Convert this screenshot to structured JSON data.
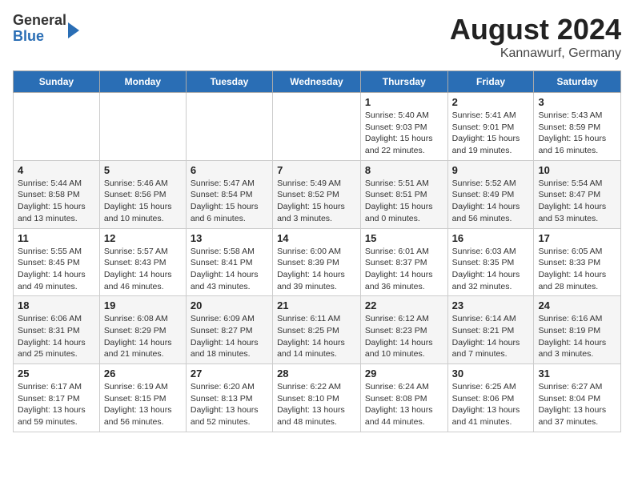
{
  "logo": {
    "general": "General",
    "blue": "Blue"
  },
  "title": {
    "month_year": "August 2024",
    "location": "Kannawurf, Germany"
  },
  "days_of_week": [
    "Sunday",
    "Monday",
    "Tuesday",
    "Wednesday",
    "Thursday",
    "Friday",
    "Saturday"
  ],
  "weeks": [
    [
      {
        "day": "",
        "info": ""
      },
      {
        "day": "",
        "info": ""
      },
      {
        "day": "",
        "info": ""
      },
      {
        "day": "",
        "info": ""
      },
      {
        "day": "1",
        "info": "Sunrise: 5:40 AM\nSunset: 9:03 PM\nDaylight: 15 hours and 22 minutes."
      },
      {
        "day": "2",
        "info": "Sunrise: 5:41 AM\nSunset: 9:01 PM\nDaylight: 15 hours and 19 minutes."
      },
      {
        "day": "3",
        "info": "Sunrise: 5:43 AM\nSunset: 8:59 PM\nDaylight: 15 hours and 16 minutes."
      }
    ],
    [
      {
        "day": "4",
        "info": "Sunrise: 5:44 AM\nSunset: 8:58 PM\nDaylight: 15 hours and 13 minutes."
      },
      {
        "day": "5",
        "info": "Sunrise: 5:46 AM\nSunset: 8:56 PM\nDaylight: 15 hours and 10 minutes."
      },
      {
        "day": "6",
        "info": "Sunrise: 5:47 AM\nSunset: 8:54 PM\nDaylight: 15 hours and 6 minutes."
      },
      {
        "day": "7",
        "info": "Sunrise: 5:49 AM\nSunset: 8:52 PM\nDaylight: 15 hours and 3 minutes."
      },
      {
        "day": "8",
        "info": "Sunrise: 5:51 AM\nSunset: 8:51 PM\nDaylight: 15 hours and 0 minutes."
      },
      {
        "day": "9",
        "info": "Sunrise: 5:52 AM\nSunset: 8:49 PM\nDaylight: 14 hours and 56 minutes."
      },
      {
        "day": "10",
        "info": "Sunrise: 5:54 AM\nSunset: 8:47 PM\nDaylight: 14 hours and 53 minutes."
      }
    ],
    [
      {
        "day": "11",
        "info": "Sunrise: 5:55 AM\nSunset: 8:45 PM\nDaylight: 14 hours and 49 minutes."
      },
      {
        "day": "12",
        "info": "Sunrise: 5:57 AM\nSunset: 8:43 PM\nDaylight: 14 hours and 46 minutes."
      },
      {
        "day": "13",
        "info": "Sunrise: 5:58 AM\nSunset: 8:41 PM\nDaylight: 14 hours and 43 minutes."
      },
      {
        "day": "14",
        "info": "Sunrise: 6:00 AM\nSunset: 8:39 PM\nDaylight: 14 hours and 39 minutes."
      },
      {
        "day": "15",
        "info": "Sunrise: 6:01 AM\nSunset: 8:37 PM\nDaylight: 14 hours and 36 minutes."
      },
      {
        "day": "16",
        "info": "Sunrise: 6:03 AM\nSunset: 8:35 PM\nDaylight: 14 hours and 32 minutes."
      },
      {
        "day": "17",
        "info": "Sunrise: 6:05 AM\nSunset: 8:33 PM\nDaylight: 14 hours and 28 minutes."
      }
    ],
    [
      {
        "day": "18",
        "info": "Sunrise: 6:06 AM\nSunset: 8:31 PM\nDaylight: 14 hours and 25 minutes."
      },
      {
        "day": "19",
        "info": "Sunrise: 6:08 AM\nSunset: 8:29 PM\nDaylight: 14 hours and 21 minutes."
      },
      {
        "day": "20",
        "info": "Sunrise: 6:09 AM\nSunset: 8:27 PM\nDaylight: 14 hours and 18 minutes."
      },
      {
        "day": "21",
        "info": "Sunrise: 6:11 AM\nSunset: 8:25 PM\nDaylight: 14 hours and 14 minutes."
      },
      {
        "day": "22",
        "info": "Sunrise: 6:12 AM\nSunset: 8:23 PM\nDaylight: 14 hours and 10 minutes."
      },
      {
        "day": "23",
        "info": "Sunrise: 6:14 AM\nSunset: 8:21 PM\nDaylight: 14 hours and 7 minutes."
      },
      {
        "day": "24",
        "info": "Sunrise: 6:16 AM\nSunset: 8:19 PM\nDaylight: 14 hours and 3 minutes."
      }
    ],
    [
      {
        "day": "25",
        "info": "Sunrise: 6:17 AM\nSunset: 8:17 PM\nDaylight: 13 hours and 59 minutes."
      },
      {
        "day": "26",
        "info": "Sunrise: 6:19 AM\nSunset: 8:15 PM\nDaylight: 13 hours and 56 minutes."
      },
      {
        "day": "27",
        "info": "Sunrise: 6:20 AM\nSunset: 8:13 PM\nDaylight: 13 hours and 52 minutes."
      },
      {
        "day": "28",
        "info": "Sunrise: 6:22 AM\nSunset: 8:10 PM\nDaylight: 13 hours and 48 minutes."
      },
      {
        "day": "29",
        "info": "Sunrise: 6:24 AM\nSunset: 8:08 PM\nDaylight: 13 hours and 44 minutes."
      },
      {
        "day": "30",
        "info": "Sunrise: 6:25 AM\nSunset: 8:06 PM\nDaylight: 13 hours and 41 minutes."
      },
      {
        "day": "31",
        "info": "Sunrise: 6:27 AM\nSunset: 8:04 PM\nDaylight: 13 hours and 37 minutes."
      }
    ]
  ]
}
